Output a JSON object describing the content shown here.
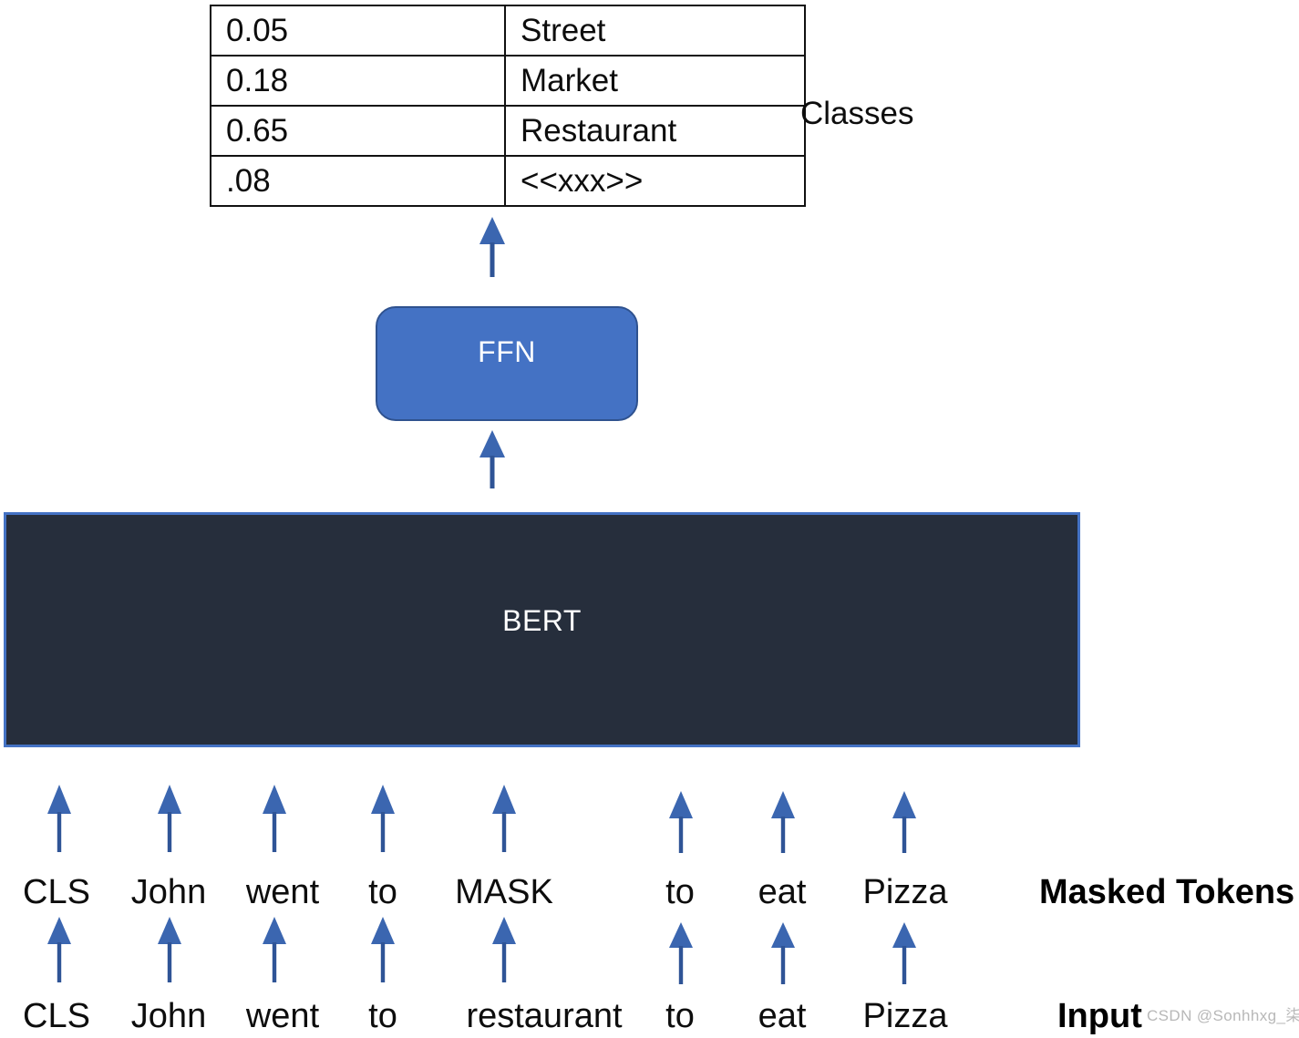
{
  "diagram": {
    "title_caption": "Classes",
    "class_table": {
      "rows": [
        {
          "prob": "0.05",
          "label": "Street"
        },
        {
          "prob": "0.18",
          "label": "Market"
        },
        {
          "prob": "0.65",
          "label": "Restaurant"
        },
        {
          "prob": ".08",
          "label": "<<xxx>>"
        }
      ]
    },
    "ffn": {
      "label": "FFN"
    },
    "bert": {
      "label": "BERT"
    },
    "masked_row": {
      "caption": "Masked Tokens",
      "tokens": [
        "CLS",
        "John",
        "went",
        "to",
        "MASK",
        "to",
        "eat",
        "Pizza"
      ]
    },
    "input_row": {
      "caption": "Input",
      "tokens": [
        "CLS",
        "John",
        "went",
        "to",
        "restaurant",
        "to",
        "eat",
        "Pizza"
      ]
    },
    "watermark": "CSDN @Sonhhxg_柒",
    "colors": {
      "accent_blue": "#4472C4",
      "bert_fill": "#262E3C",
      "arrow_blue": "#3B66B0",
      "table_border": "#111111",
      "text": "#0D0D0D"
    }
  }
}
